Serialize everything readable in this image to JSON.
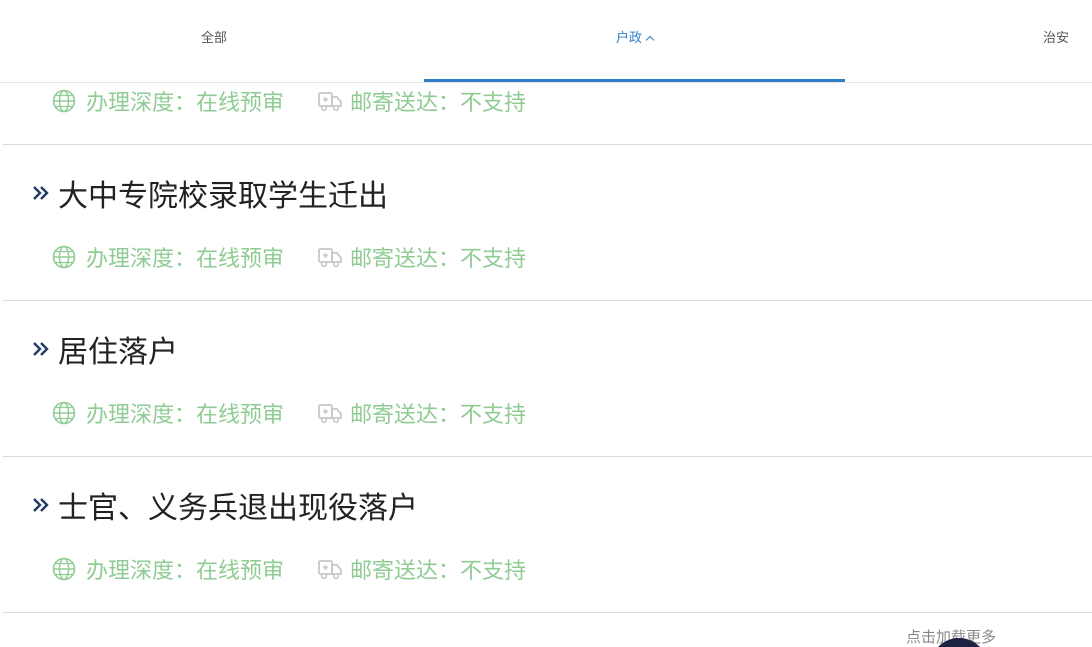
{
  "tabs": [
    {
      "label": "全部"
    },
    {
      "label": "户政",
      "active": true
    },
    {
      "label": "治安"
    }
  ],
  "colors": {
    "accent": "#2a7fc7",
    "meta_green": "#8fcc93",
    "title_text": "#222222"
  },
  "items": [
    {
      "title": "",
      "depth_label": "办理深度：在线预审",
      "mail_label": "邮寄送达：不支持"
    },
    {
      "title": "大中专院校录取学生迁出",
      "depth_label": "办理深度：在线预审",
      "mail_label": "邮寄送达：不支持"
    },
    {
      "title": "居住落户",
      "depth_label": "办理深度：在线预审",
      "mail_label": "邮寄送达：不支持"
    },
    {
      "title": "士官、义务兵退出现役落户",
      "depth_label": "办理深度：在线预审",
      "mail_label": "邮寄送达：不支持"
    }
  ],
  "load_more": "点击加载更多",
  "icons": {
    "globe": "globe-icon",
    "truck": "truck-icon",
    "bullet": "double-chevron-right-icon",
    "tab_chevron": "chevron-up-icon"
  }
}
